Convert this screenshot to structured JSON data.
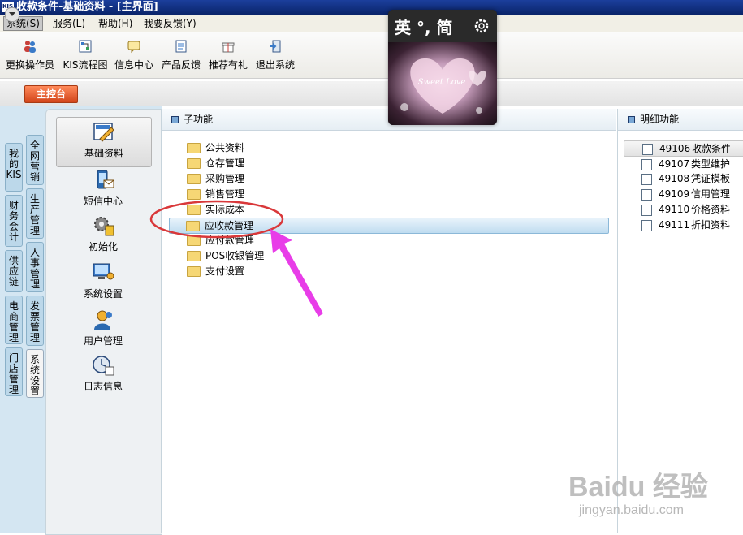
{
  "window": {
    "title": "收款条件-基础资料 - [主界面]",
    "logo": "KIS"
  },
  "menu": [
    {
      "label": "系统(S)"
    },
    {
      "label": "服务(L)"
    },
    {
      "label": "帮助(H)"
    },
    {
      "label": "我要反馈(Y)"
    }
  ],
  "toolbar": [
    {
      "label": "更换操作员",
      "icon": "users-icon"
    },
    {
      "label": "KIS流程图",
      "icon": "flowchart-icon"
    },
    {
      "label": "信息中心",
      "icon": "message-icon"
    },
    {
      "label": "产品反馈",
      "icon": "feedback-icon"
    },
    {
      "label": "推荐有礼",
      "icon": "gift-icon"
    },
    {
      "label": "退出系统",
      "icon": "exit-icon"
    }
  ],
  "main_tab": "主控台",
  "vertical_tabs_outer": [
    "我的KIS",
    "财务会计",
    "供应链",
    "电商管理",
    "门店管理"
  ],
  "vertical_tabs_inner": [
    "全网营销",
    "生产管理",
    "人事管理",
    "发票管理",
    "系统设置"
  ],
  "modules": [
    {
      "label": "基础资料",
      "icon": "basic-data-icon"
    },
    {
      "label": "短信中心",
      "icon": "sms-icon"
    },
    {
      "label": "初始化",
      "icon": "init-gear-icon"
    },
    {
      "label": "系统设置",
      "icon": "system-settings-icon"
    },
    {
      "label": "用户管理",
      "icon": "user-admin-icon"
    },
    {
      "label": "日志信息",
      "icon": "log-clock-icon"
    }
  ],
  "sub_panel": {
    "header": "子功能",
    "items": [
      "公共资料",
      "仓存管理",
      "采购管理",
      "销售管理",
      "实际成本",
      "应收款管理",
      "应付款管理",
      "POS收银管理",
      "支付设置"
    ],
    "selected_index": 5
  },
  "detail_panel": {
    "header": "明细功能",
    "items": [
      {
        "code": "49106",
        "label": "收款条件"
      },
      {
        "code": "49107",
        "label": "类型维护"
      },
      {
        "code": "49108",
        "label": "凭证模板"
      },
      {
        "code": "49109",
        "label": "信用管理"
      },
      {
        "code": "49110",
        "label": "价格资料"
      },
      {
        "code": "49111",
        "label": "折扣资料"
      }
    ],
    "selected_index": 0
  },
  "popup": {
    "heading": "英 °, 简",
    "image_text": "Sweet Love"
  },
  "watermark": {
    "brand": "Baidu 经验",
    "url": "jingyan.baidu.com"
  },
  "annotation_color": "#e83de8",
  "highlight_color": "#d9383a"
}
